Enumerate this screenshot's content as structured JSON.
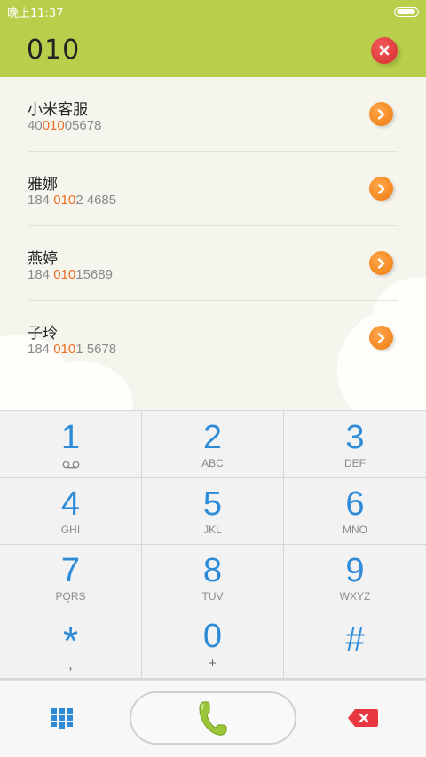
{
  "status_bar": {
    "time": "晚上11:37",
    "battery_level": 0.95
  },
  "header": {
    "dialed_number": "010"
  },
  "contacts": [
    {
      "name": "小米客服",
      "phone_pre": "40",
      "phone_hl": "010",
      "phone_post": "05678"
    },
    {
      "name": "雅娜",
      "phone_pre": "184 ",
      "phone_hl": "010",
      "phone_post": "2 4685"
    },
    {
      "name": "燕婷",
      "phone_pre": "184 ",
      "phone_hl": "010",
      "phone_post": "15689"
    },
    {
      "name": "子玲",
      "phone_pre": "184 ",
      "phone_hl": "010",
      "phone_post": "1 5678"
    }
  ],
  "keypad": [
    {
      "digit": "1",
      "letters": "",
      "icon": "voicemail-icon"
    },
    {
      "digit": "2",
      "letters": "ABC"
    },
    {
      "digit": "3",
      "letters": "DEF"
    },
    {
      "digit": "4",
      "letters": "GHI"
    },
    {
      "digit": "5",
      "letters": "JKL"
    },
    {
      "digit": "6",
      "letters": "MNO"
    },
    {
      "digit": "7",
      "letters": "PQRS"
    },
    {
      "digit": "8",
      "letters": "TUV"
    },
    {
      "digit": "9",
      "letters": "WXYZ"
    },
    {
      "digit": "*",
      "letters": ","
    },
    {
      "digit": "0",
      "letters": "+"
    },
    {
      "digit": "#",
      "letters": ""
    }
  ],
  "bottom_bar": {
    "keypad_toggle_icon": "dialpad-icon",
    "call_icon": "phone-icon",
    "delete_icon": "backspace-icon"
  },
  "colors": {
    "header": "#b7cf4a",
    "highlight": "#ee6c21",
    "digit": "#2e8bd8",
    "call": "#9cc63a"
  }
}
